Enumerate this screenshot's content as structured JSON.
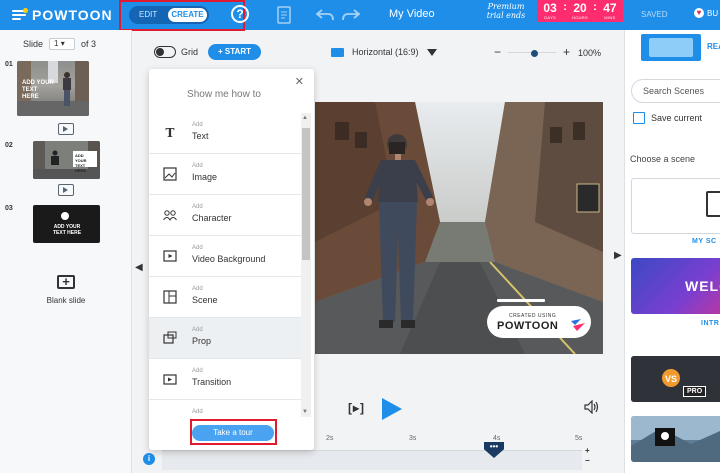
{
  "topbar": {
    "logo": "POWTOON",
    "mode_edit": "EDIT",
    "mode_create": "CREATE",
    "help": "?",
    "video_title": "My Video",
    "trial_text": "Premium trial ends",
    "timer": [
      {
        "num": "03",
        "label": "DAYS"
      },
      {
        "num": "20",
        "label": "HOURS"
      },
      {
        "num": "47",
        "label": "MINS"
      }
    ],
    "saved": "SAVED",
    "user_label": "BU"
  },
  "leftpanel": {
    "slide_label": "Slide",
    "slide_current": "1",
    "slide_total": "of 3",
    "slides": [
      {
        "num": "01",
        "thumb_text": "ADD YOUR TEXT HERE"
      },
      {
        "num": "02",
        "thumb_text": "ADD YOUR TEXT HERE"
      },
      {
        "num": "03",
        "thumb_text": "ADD YOUR TEXT HERE"
      }
    ],
    "blank_slide": "Blank slide"
  },
  "canvas_toolbar": {
    "grid_label": "Grid",
    "start_label": "+ START",
    "orientation": "Horizontal (16:9)",
    "zoom_pct": "100%",
    "zoom_level": 0.55
  },
  "stage": {
    "created_using": "CREATED USING",
    "brand": "POWTOON"
  },
  "popup": {
    "title": "Show me how to",
    "add_label": "Add",
    "items": [
      {
        "name": "Text",
        "icon": "text-icon"
      },
      {
        "name": "Image",
        "icon": "image-icon"
      },
      {
        "name": "Character",
        "icon": "character-icon"
      },
      {
        "name": "Video Background",
        "icon": "video-background-icon"
      },
      {
        "name": "Scene",
        "icon": "scene-icon"
      },
      {
        "name": "Prop",
        "icon": "prop-icon"
      },
      {
        "name": "Transition",
        "icon": "transition-icon"
      },
      {
        "name": "",
        "icon": "more-icon"
      }
    ],
    "tour_label": "Take a tour"
  },
  "playback": {
    "frame_label": "[▸]"
  },
  "timeline": {
    "ticks": [
      "2s",
      "3s",
      "4s",
      "5s"
    ],
    "playhead_label": "•••",
    "info": "i",
    "plus": "+",
    "minus": "−"
  },
  "rightpanel": {
    "tab": "REA",
    "search_placeholder": "Search Scenes",
    "save_current": "Save current",
    "choose_scene": "Choose a scene",
    "my_scene_label": "MY SC",
    "welcome_text": "WELC",
    "intro_label": "INTR",
    "pro_badge": "PRO"
  },
  "colors": {
    "brand_blue": "#1f8ee8",
    "timer_pink": "#ff2d6f",
    "highlight_red": "#e01b2f"
  }
}
